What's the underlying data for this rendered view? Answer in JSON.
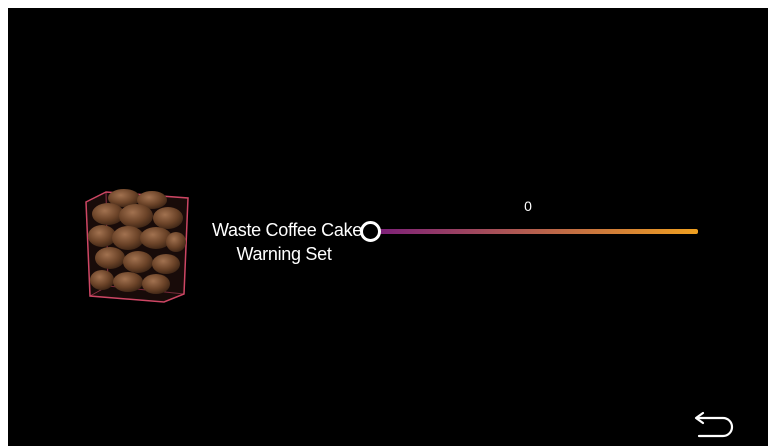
{
  "setting": {
    "title_line1": "Waste Coffee Cake",
    "title_line2": "Warning Set"
  },
  "slider": {
    "value": "0",
    "level": 0,
    "track_colors": [
      "#7a1e7a",
      "#f0a020"
    ]
  },
  "icons": {
    "back": "return-arrow-icon",
    "bin": "coffee-grounds-bin-image"
  },
  "colors": {
    "background": "#000000",
    "text": "#ffffff",
    "bin_outline": "#d84a6a"
  }
}
